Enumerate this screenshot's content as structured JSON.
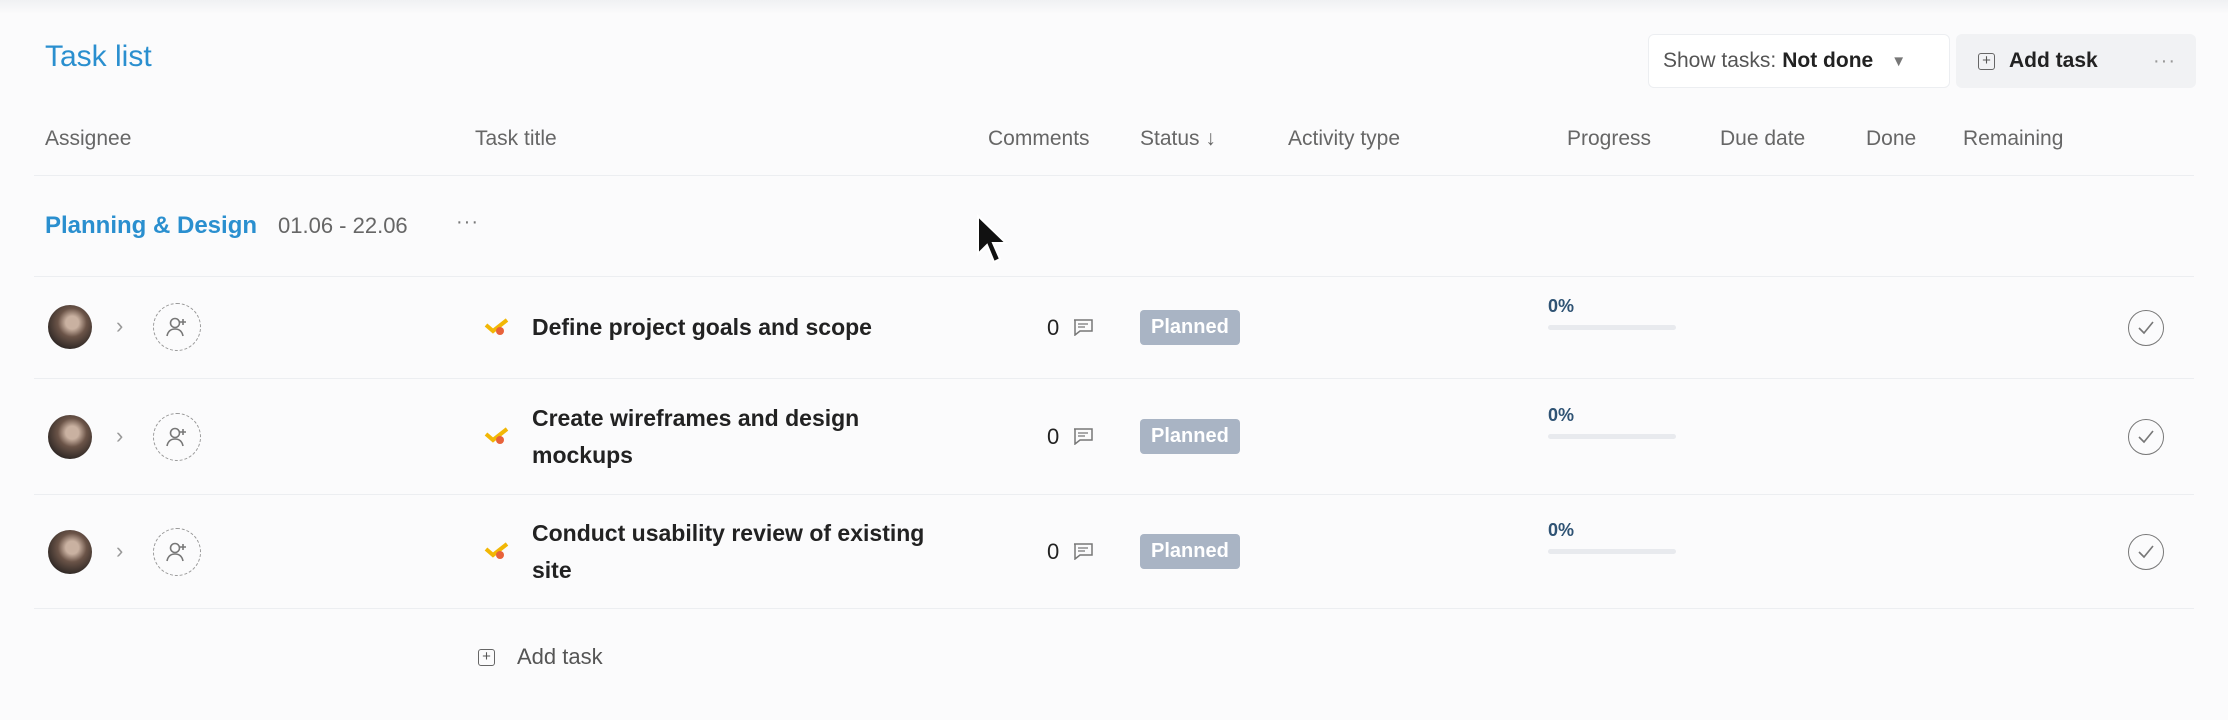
{
  "header": {
    "title": "Task list",
    "filter_label": "Show tasks:",
    "filter_value": "Not done",
    "add_task_label": "Add task",
    "more_label": "···"
  },
  "columns": {
    "assignee": "Assignee",
    "task_title": "Task title",
    "comments": "Comments",
    "status": "Status ↓",
    "activity_type": "Activity type",
    "progress": "Progress",
    "due_date": "Due date",
    "done": "Done",
    "remaining": "Remaining"
  },
  "group": {
    "name": "Planning & Design",
    "dates": "01.06 - 22.06",
    "more_label": "···"
  },
  "tasks": [
    {
      "title": "Define project goals and scope",
      "comments": "0",
      "status": "Planned",
      "progress_label": "0%",
      "progress": 0
    },
    {
      "title": "Create wireframes and design mockups",
      "comments": "0",
      "status": "Planned",
      "progress_label": "0%",
      "progress": 0
    },
    {
      "title": "Conduct usability review of existing site",
      "comments": "0",
      "status": "Planned",
      "progress_label": "0%",
      "progress": 0
    }
  ],
  "footer": {
    "add_task_label": "Add task"
  },
  "colors": {
    "accent": "#2a8fcf",
    "status_planned": "#a9b4c4",
    "progress": "#2f5374"
  },
  "icons": [
    "chevron-right-icon",
    "add-user-icon",
    "task-type-icon",
    "comment-icon",
    "check-circle-icon",
    "plus-square-icon",
    "caret-down-icon",
    "mouse-cursor-icon"
  ]
}
